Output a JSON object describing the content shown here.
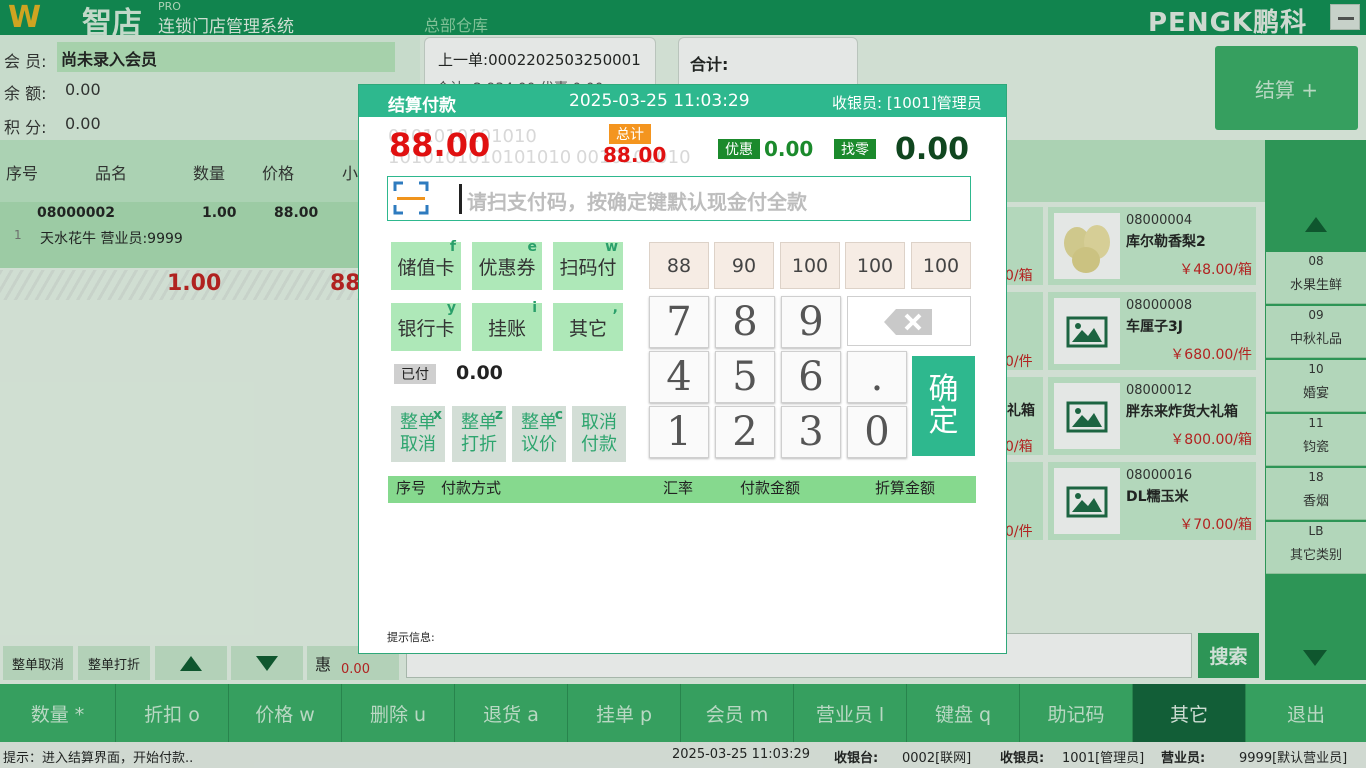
{
  "app": {
    "logo": "W",
    "name": "智店",
    "pro": "PRO",
    "subtitle": "连锁门店管理系统",
    "warehouse": "总部仓库",
    "brand": "PENGK鹏科"
  },
  "member": {
    "label": "会 员:",
    "value": "尚未录入会员",
    "balance_label": "余 额:",
    "balance": "0.00",
    "points_label": "积 分:",
    "points": "0.00"
  },
  "last_order": {
    "label": "上一单:",
    "no": "0002202503250001",
    "sum_frag": "合计: 2,934.00   优惠 0.00"
  },
  "total": {
    "label": "合计:"
  },
  "settle_button": "结算 +",
  "table": {
    "headers": [
      "序号",
      "品名",
      "数量",
      "价格",
      "小"
    ],
    "row": {
      "index": "1",
      "code": "08000002",
      "qty": "1.00",
      "price": "88.00",
      "name": "天水花牛 营业员:9999"
    },
    "sum_qty": "1.00",
    "sum_amt": "88"
  },
  "categories": [
    {
      "code": "08",
      "name": "水果生鲜"
    },
    {
      "code": "09",
      "name": "中秋礼品"
    },
    {
      "code": "10",
      "name": "婚宴"
    },
    {
      "code": "11",
      "name": "钧瓷"
    },
    {
      "code": "18",
      "name": "香烟"
    },
    {
      "code": "LB",
      "name": "其它类别"
    }
  ],
  "products": [
    {
      "code": "08000004",
      "name": "库尔勒香梨2",
      "price": "￥48.00/箱"
    },
    {
      "code": "08000008",
      "name": "车厘子3J",
      "price": "￥680.00/件"
    },
    {
      "code": "08000012",
      "name": "胖东来炸货大礼箱",
      "price": "￥800.00/箱"
    },
    {
      "code": "08000016",
      "name": "DL糯玉米",
      "price": "￥70.00/箱"
    }
  ],
  "price_frags": [
    "0/箱",
    "0/件",
    "礼箱",
    "0/箱",
    "0/件"
  ],
  "small_buttons": {
    "cancel_all": "整单取消",
    "discount_all": "整单打折",
    "hui": "惠",
    "hui_val": "0.00",
    "search": "搜索"
  },
  "fkeys": [
    "数量 *",
    "折扣 o",
    "价格 w",
    "删除 u",
    "退货 a",
    "挂单 p",
    "会员 m",
    "营业员 l",
    "键盘 q",
    "助记码",
    "其它",
    "退出"
  ],
  "status": {
    "tip": "提示：进入结算界面，开始付款..",
    "time": "2025-03-25 11:03:29",
    "pos_label": "收银台:",
    "pos": "0002[联网]",
    "cashier_label": "收银员:",
    "cashier": "1001[管理员]",
    "clerk_label": "营业员:",
    "clerk": "9999[默认营业员]"
  },
  "modal": {
    "title": "结算付款",
    "datetime": "2025-03-25 11:03:29",
    "cashier": "收银员: [1001]管理员",
    "due": "88.00",
    "total_tag": "总计",
    "total": "88.00",
    "discount_tag": "优惠",
    "discount": "0.00",
    "change_tag": "找零",
    "change": "0.00",
    "watermark1": "0101010101010",
    "watermark2": "1010101010101010",
    "watermark3": "0010101010",
    "input_placeholder": "请扫支付码，按确定键默认现金付全款",
    "pay_methods": [
      {
        "label": "储值卡",
        "key": "f"
      },
      {
        "label": "优惠券",
        "key": "e"
      },
      {
        "label": "扫码付",
        "key": "w"
      },
      {
        "label": "银行卡",
        "key": "y"
      },
      {
        "label": "挂账",
        "key": "i"
      },
      {
        "label": "其它",
        "key": ","
      }
    ],
    "paid_tag": "已付",
    "paid": "0.00",
    "actions": [
      {
        "l1": "整单",
        "l2": "取消",
        "key": "x"
      },
      {
        "l1": "整单",
        "l2": "打折",
        "key": "z"
      },
      {
        "l1": "整单",
        "l2": "议价",
        "key": "c"
      },
      {
        "l1": "取消",
        "l2": "付款",
        "key": ""
      }
    ],
    "quick": [
      "88",
      "90",
      "100",
      "100",
      "100"
    ],
    "keys": [
      "7",
      "8",
      "9",
      "4",
      "5",
      "6",
      ".",
      "1",
      "2",
      "3",
      "0"
    ],
    "confirm1": "确",
    "confirm2": "定",
    "pay_table_headers": {
      "idx": "序号",
      "method": "付款方式",
      "rate": "汇率",
      "amount": "付款金额",
      "converted": "折算金额"
    },
    "hint": "提示信息:"
  }
}
